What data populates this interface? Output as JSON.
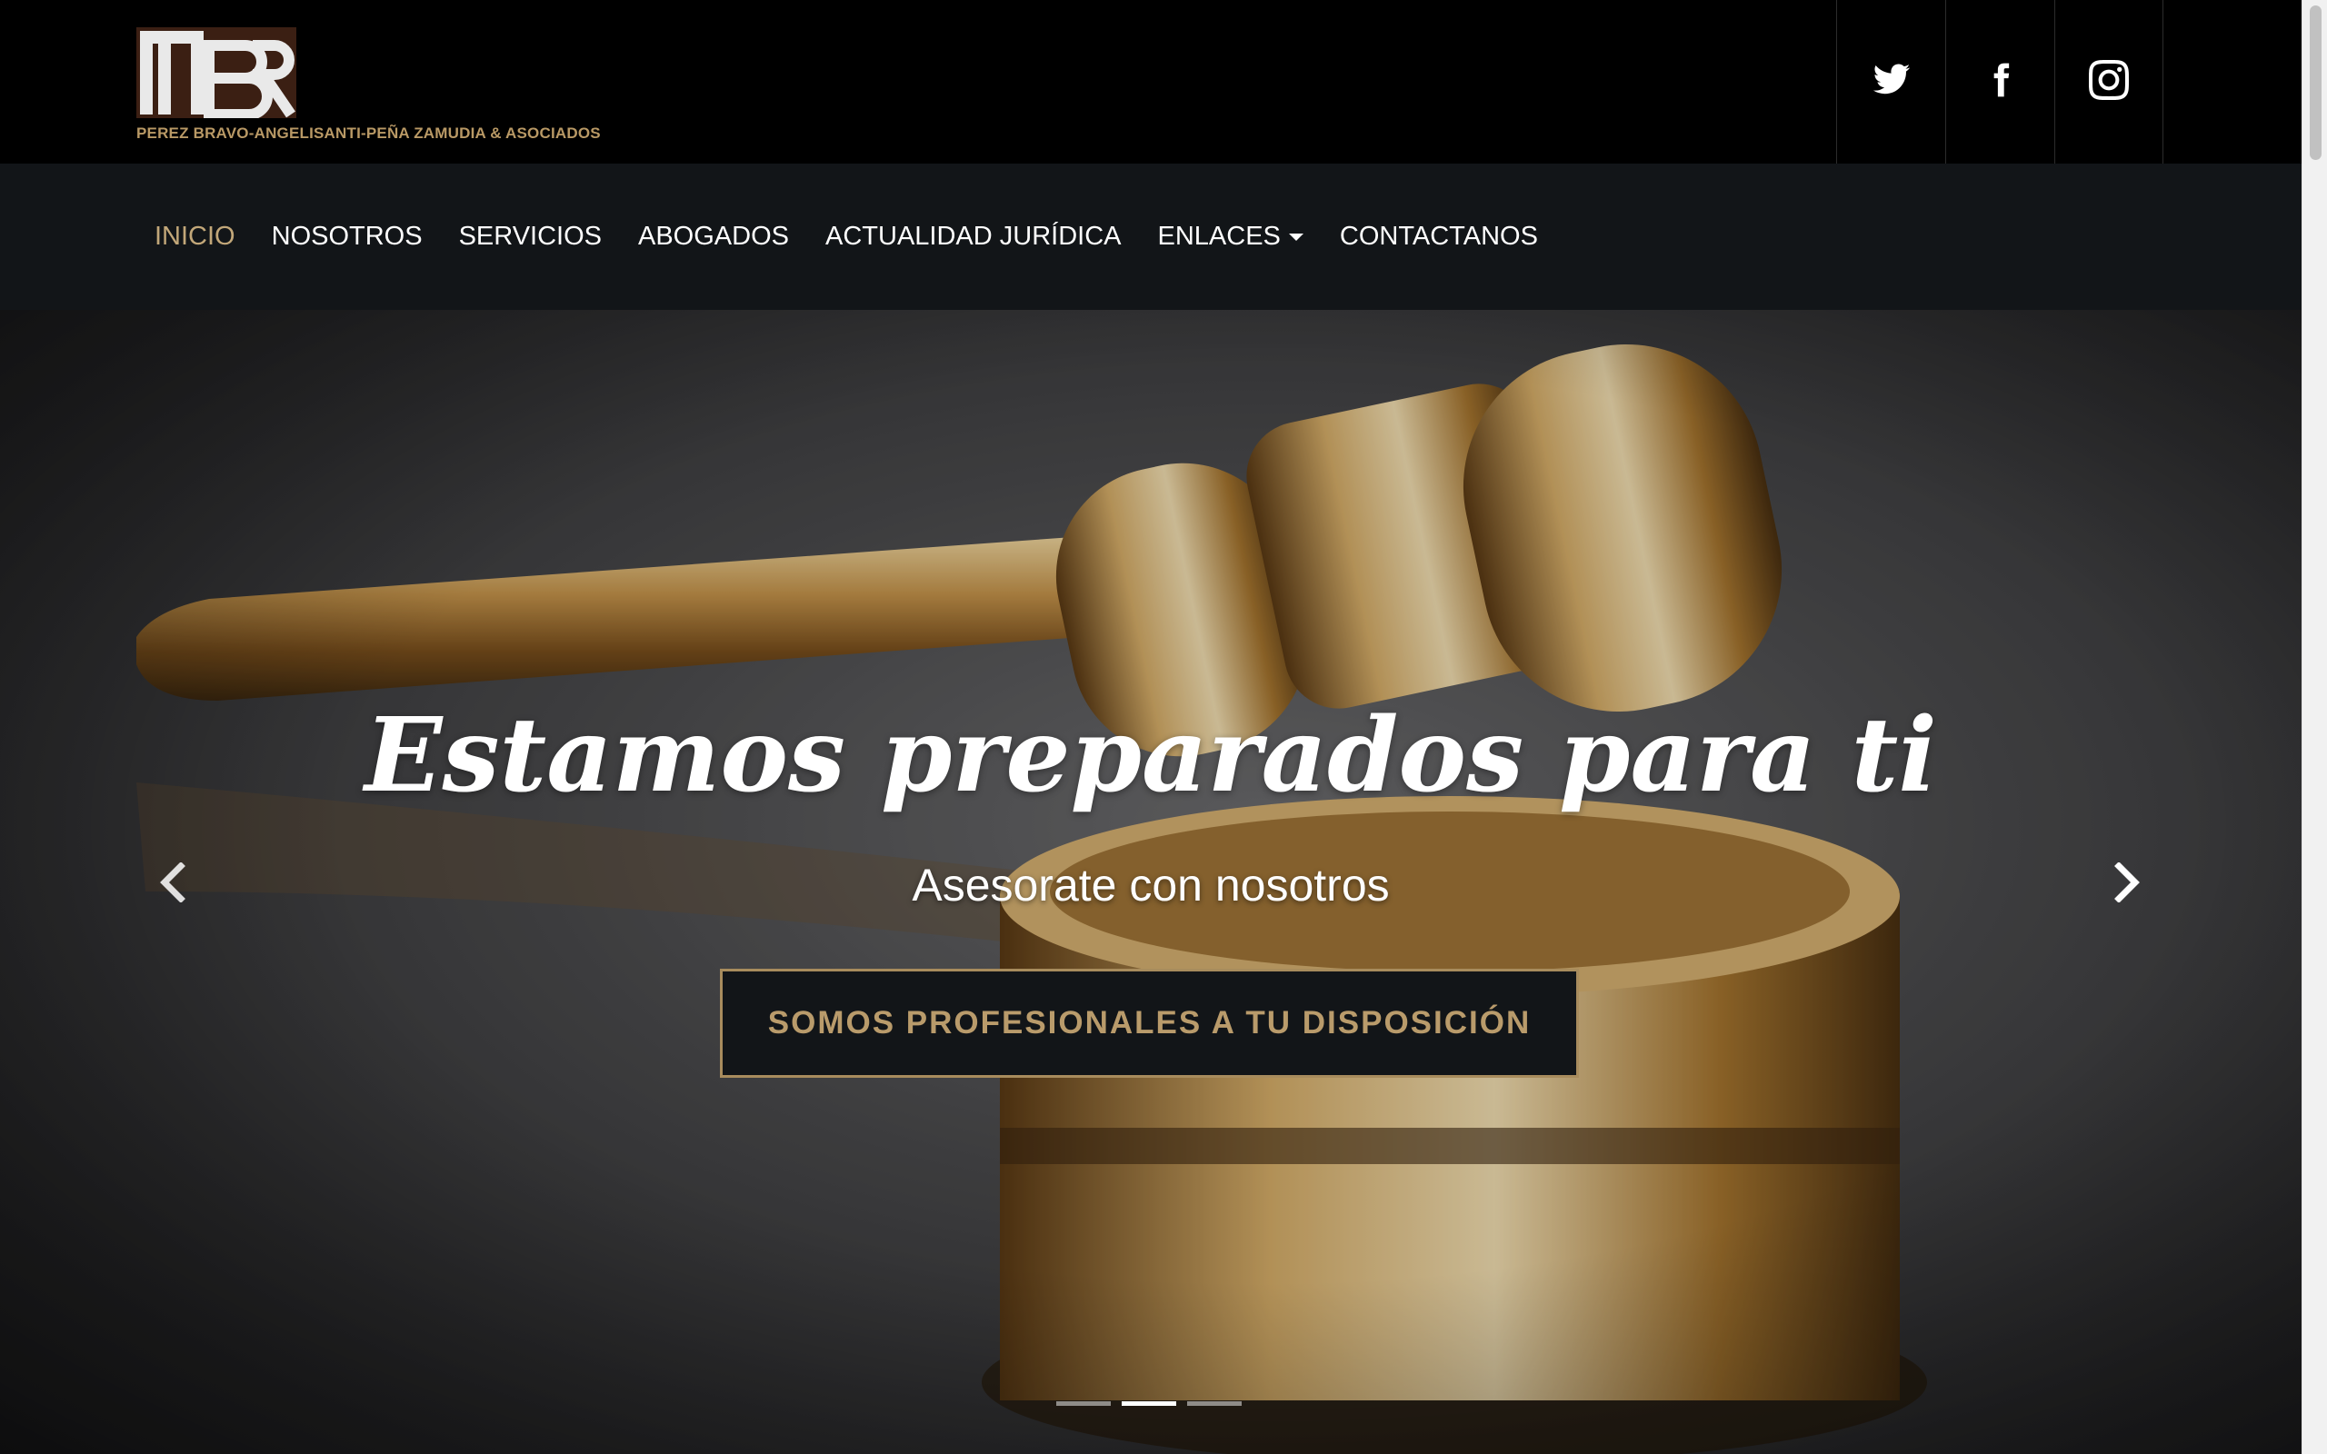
{
  "brand": {
    "logo_letters": "PBR",
    "name": "PEREZ BRAVO-ANGELISANTI-PEÑA ZAMUDIA & ASOCIADOS"
  },
  "social": [
    {
      "icon": "twitter-icon"
    },
    {
      "icon": "facebook-icon"
    },
    {
      "icon": "instagram-icon"
    }
  ],
  "nav": {
    "items": [
      {
        "label": "INICIO",
        "active": true
      },
      {
        "label": "NOSOTROS"
      },
      {
        "label": "SERVICIOS"
      },
      {
        "label": "ABOGADOS"
      },
      {
        "label": "ACTUALIDAD JURÍDICA"
      },
      {
        "label": "ENLACES",
        "dropdown": true
      },
      {
        "label": "CONTACTANOS"
      }
    ]
  },
  "hero": {
    "title": "Estamos preparados para ti",
    "subtitle": "Asesorate con nosotros",
    "cta": "SOMOS PROFESIONALES A TU DISPOSICIÓN",
    "slides_count": 3,
    "active_slide": 2
  },
  "colors": {
    "accent_gold": "#c2a779",
    "button_text": "#b99b6b",
    "navbar_bg": "#121518",
    "topbar_bg": "#000000"
  }
}
